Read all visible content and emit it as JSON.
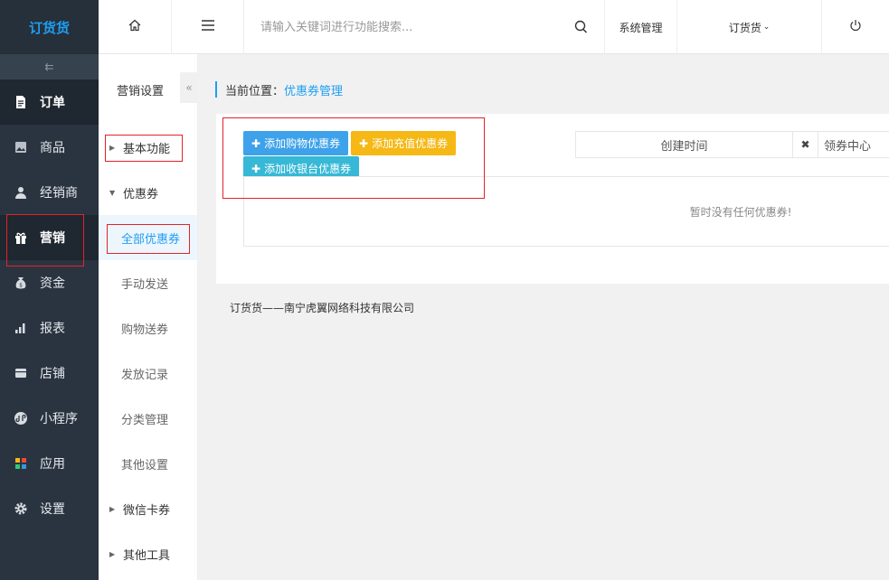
{
  "logo": "订货货",
  "nav": [
    {
      "label": "订单",
      "icon": "document-icon"
    },
    {
      "label": "商品",
      "icon": "image-icon"
    },
    {
      "label": "经销商",
      "icon": "user-icon"
    },
    {
      "label": "营销",
      "icon": "gift-icon",
      "active": true
    },
    {
      "label": "资金",
      "icon": "money-bag-icon"
    },
    {
      "label": "报表",
      "icon": "bar-chart-icon"
    },
    {
      "label": "店铺",
      "icon": "store-icon"
    },
    {
      "label": "小程序",
      "icon": "mini-program-icon"
    },
    {
      "label": "应用",
      "icon": "apps-icon"
    },
    {
      "label": "设置",
      "icon": "gear-icon"
    }
  ],
  "header": {
    "search_placeholder": "请输入关键词进行功能搜索...",
    "system_label": "系统管理",
    "account_label": "订货货"
  },
  "subnav": {
    "title": "营销设置",
    "basic": "基本功能",
    "coupon_group": "优惠券",
    "all_coupons": "全部优惠券",
    "manual_send": "手动发送",
    "purchase_gift": "购物送券",
    "send_records": "发放记录",
    "category_mgmt": "分类管理",
    "other_settings": "其他设置",
    "wechat_card": "微信卡券",
    "other_tools": "其他工具"
  },
  "breadcrumb": {
    "prefix": "当前位置：",
    "current": "优惠券管理"
  },
  "buttons": {
    "add_shopping": "添加购物优惠券",
    "add_recharge": "添加充值优惠券",
    "add_cashier": "添加收银台优惠券"
  },
  "filters": {
    "created_time": "创建时间",
    "coupon_center": "领券中心"
  },
  "empty_text": "暂时没有任何优惠券!",
  "footer": "订货货——南宁虎翼网络科技有限公司",
  "colors": {
    "accent": "#1e9ff2",
    "nav_bg": "#2a3440",
    "highlight": "#e0242b"
  }
}
